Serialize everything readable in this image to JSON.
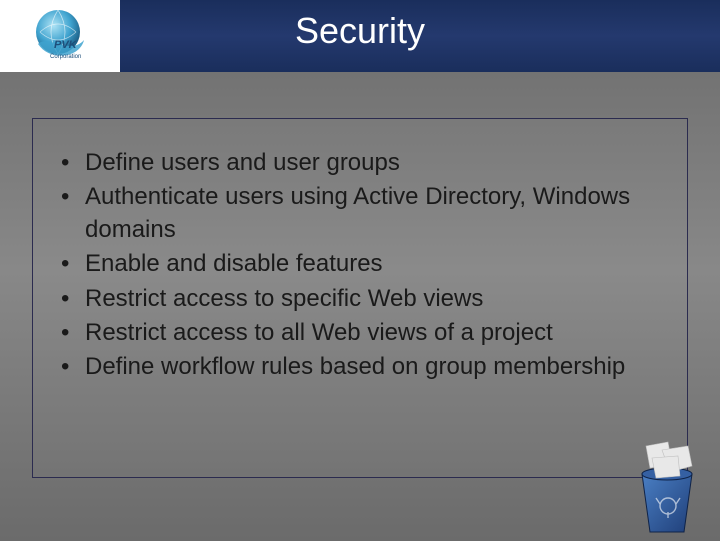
{
  "header": {
    "title": "Security",
    "logo_text_top": "PVK",
    "logo_text_bottom": "Corporation"
  },
  "bullets": [
    "Define users and user groups",
    "Authenticate users using Active Directory, Windows domains",
    "Enable and disable features",
    "Restrict access to specific Web views",
    "Restrict access to all Web views of a project",
    "Define workflow rules based on group membership"
  ],
  "decor": {
    "recycle_bin": "recycle-bin-icon"
  }
}
